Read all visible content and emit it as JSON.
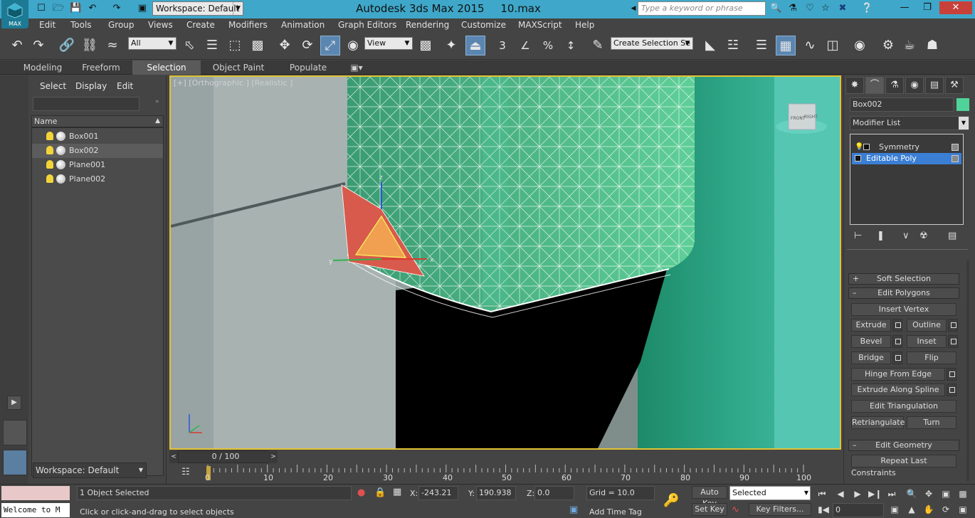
{
  "titlebar": {
    "app_logo": "MAX",
    "workspace": "Workspace: Default",
    "title": "Autodesk 3ds Max  2015",
    "file": "10.max",
    "search_placeholder": "Type a keyword or phrase"
  },
  "menu": [
    "Edit",
    "Tools",
    "Group",
    "Views",
    "Create",
    "Modifiers",
    "Animation",
    "Graph Editors",
    "Rendering",
    "Customize",
    "MAXScript",
    "Help"
  ],
  "toolbar": {
    "filter": "All",
    "ref_coord": "View",
    "selection_set": "Create Selection Se",
    "snap_3": "3",
    "angle_snap": "∠",
    "percent_snap": "%",
    "spinner_snap": "↕"
  },
  "ribbon": {
    "tabs": [
      "Modeling",
      "Freeform",
      "Selection",
      "Object Paint",
      "Populate"
    ]
  },
  "explorer": {
    "menu": [
      "Select",
      "Display",
      "Edit"
    ],
    "column": "Name",
    "objects": [
      "Box001",
      "Box002",
      "Plane001",
      "Plane002"
    ],
    "selected": "Box002",
    "workspace": "Workspace: Default"
  },
  "viewport": {
    "label": "[+] [Orthographic ] [Realistic ]",
    "gizmo_axes": [
      "z",
      "y",
      "x"
    ],
    "cube_labels": [
      "FRONT",
      "RIGHT"
    ]
  },
  "timeslider": {
    "frame": "0 / 100",
    "ticks": [
      "0",
      "10",
      "20",
      "30",
      "40",
      "50",
      "60",
      "70",
      "80",
      "90",
      "100"
    ]
  },
  "command_panel": {
    "object_name": "Box002",
    "object_color": "#50d39a",
    "modifier_list": "Modifier List",
    "stack": [
      "Symmetry",
      "Editable Poly"
    ],
    "rollouts": {
      "soft_selection": "Soft Selection",
      "edit_polygons": "Edit Polygons",
      "edit_geometry": "Edit Geometry",
      "constraints": "Constraints"
    },
    "buttons": {
      "insert_vertex": "Insert Vertex",
      "extrude": "Extrude",
      "outline": "Outline",
      "bevel": "Bevel",
      "inset": "Inset",
      "bridge": "Bridge",
      "flip": "Flip",
      "hinge": "Hinge From Edge",
      "extrude_spline": "Extrude Along Spline",
      "edit_tri": "Edit Triangulation",
      "retriangulate": "Retriangulate",
      "turn": "Turn",
      "repeat_last": "Repeat Last"
    }
  },
  "status": {
    "listener": "Welcome to M",
    "selected_count": "1 Object Selected",
    "prompt": "Click or click-and-drag to select objects",
    "x_label": "X:",
    "x": "-243.21",
    "y_label": "Y:",
    "y": "190.938",
    "z_label": "Z:",
    "z": "0.0",
    "grid": "Grid = 10.0",
    "add_time_tag": "Add Time Tag",
    "auto_key": "Auto Key",
    "set_key": "Set Key",
    "selected_combo": "Selected",
    "key_filters": "Key Filters...",
    "frame": "0"
  },
  "colors": {
    "titlebar": "#3fa7c9",
    "viewport_border": "#e1c232",
    "stack_selection": "#3b7fd5",
    "close_button": "#c7413a"
  }
}
